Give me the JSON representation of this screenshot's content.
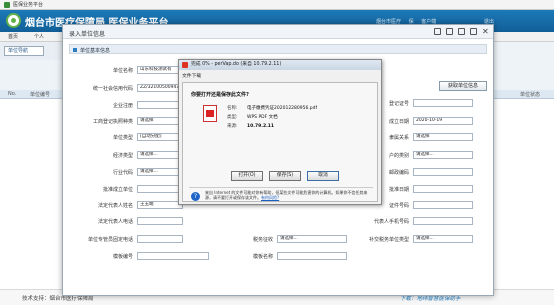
{
  "window": {
    "title": "医保业务平台"
  },
  "banner": {
    "title": "烟台市医疗保障局 医保业务平台",
    "user_items": [
      "烟台市医疗",
      "保",
      "客户端",
      "",
      "退出"
    ]
  },
  "nav": {
    "tabs": [
      "首页",
      "个人"
    ]
  },
  "subnav": {
    "item": "单位导航"
  },
  "background_grid": {
    "headers": [
      "No.",
      "单位编号",
      "单位状态"
    ]
  },
  "footer": {
    "support": "技术支持：烟台市医疗保障局",
    "download": "下载：地纬智慧医保助手"
  },
  "dialog": {
    "title": "录入单位信息",
    "section": "单位基本信息",
    "fields": {
      "unit_name": {
        "label": "单位名称",
        "value": "山东科技测试有"
      },
      "credit_code": {
        "label": "统一社会信用代码",
        "value": "ZZ/321005009476"
      },
      "fetch_button": "获取单位信息",
      "reg_cert": {
        "label": "登记证号"
      },
      "enterprise_type": {
        "label": "企业注册"
      },
      "reg_date": {
        "label": "成立日期",
        "value": "2020-10-19"
      },
      "biz_reg": {
        "label": "工商登记执照种类",
        "value": "请选择"
      },
      "unit_type": {
        "label": "单位类型",
        "value": "[自动分配]"
      },
      "affiliation": {
        "label": "隶属关系",
        "value": "请选择"
      },
      "economic_type": {
        "label": "经济类型",
        "value": "请选择..."
      },
      "industry_code": {
        "label": "行业代码",
        "value": "请选择..."
      },
      "bank_class": {
        "label": "户的类别",
        "value": "请选择..."
      },
      "postal_code": {
        "label": "邮政编码"
      },
      "approve_unit": {
        "label": "批准成立单位"
      },
      "approve_date": {
        "label": "批准日期"
      },
      "legal_person": {
        "label": "法定代表人姓名",
        "value": "王玉端"
      },
      "cert_type": {
        "label": "证件号码"
      },
      "legal_phone": {
        "label": "法定代表人电话"
      },
      "legal_mobile": {
        "label": "代表人手机号码"
      },
      "manage_phone": {
        "label": "单位专管员固定电话"
      },
      "tax_collect": {
        "label": "税务征收",
        "value": "请选择..."
      },
      "tax_type": {
        "label": "补交税务单位类型",
        "value": "请选择..."
      },
      "template_no": {
        "label": "模板编号"
      },
      "template_name": {
        "label": "模板名称"
      }
    }
  },
  "ie_bar": {
    "text": "完成 0% - perVap.do (来自 10.79.2.11)"
  },
  "download_dialog": {
    "title": "文件下载",
    "question": "你要打开还是保存此文件?",
    "name_key": "名称:",
    "name_val": "电子缴费凭证202012280956.pdf",
    "type_key": "类型:",
    "type_val": "WPS PDF 文档",
    "from_key": "来源:",
    "from_val": "10.79.2.11",
    "open": "打开(O)",
    "save": "保存(S)",
    "cancel": "取消",
    "warning": "来自 Internet 的文件可能对你有帮助，但某些文件可能危害你的计算机。如果你不信任其来源，请不要打开或保存该文件。",
    "risk_link": "有何风险?"
  }
}
